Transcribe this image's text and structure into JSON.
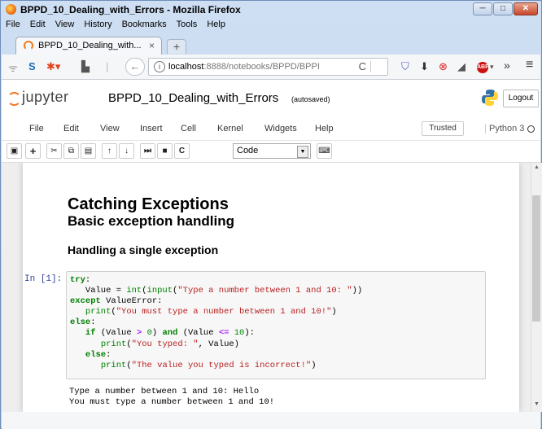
{
  "window": {
    "title": "BPPD_10_Dealing_with_Errors - Mozilla Firefox",
    "minimize_glyph": "─",
    "restore_glyph": "□",
    "close_glyph": "✕"
  },
  "menubar": [
    "File",
    "Edit",
    "View",
    "History",
    "Bookmarks",
    "Tools",
    "Help"
  ],
  "tab": {
    "label": "BPPD_10_Dealing_with...",
    "close": "×",
    "new": "+"
  },
  "navbar": {
    "url_host": "localhost",
    "url_path": ":8888/notebooks/BPPD/BPPI",
    "back_glyph": "←",
    "reload_glyph": "C",
    "abp_label": "ABP",
    "overflow_glyph": "»",
    "menu_glyph": "≡"
  },
  "jupyter": {
    "brand": "jupyter",
    "notebook_title": "BPPD_10_Dealing_with_Errors",
    "autosave": "(autosaved)",
    "logout": "Logout",
    "menu": [
      "File",
      "Edit",
      "View",
      "Insert",
      "Cell",
      "Kernel",
      "Widgets",
      "Help"
    ],
    "trusted": "Trusted",
    "kernel": "Python 3",
    "cell_type": "Code"
  },
  "toolbar_icons": [
    "save-icon",
    "add-cell-icon",
    "cut-icon",
    "copy-icon",
    "paste-icon",
    "move-up-icon",
    "move-down-icon",
    "run-icon",
    "stop-icon",
    "restart-icon",
    "keyboard-icon"
  ],
  "notebook": {
    "h1": "Catching Exceptions",
    "h2": "Basic exception handling",
    "h3": "Handling a single exception",
    "prompt": "In [1]:",
    "code_lines": [
      "try:",
      "   Value = int(input(\"Type a number between 1 and 10: \"))",
      "except ValueError:",
      "   print(\"You must type a number between 1 and 10!\")",
      "else:",
      "   if (Value > 0) and (Value <= 10):",
      "      print(\"You typed: \", Value)",
      "   else:",
      "      print(\"The value you typed is incorrect!\")"
    ],
    "output_lines": [
      "Type a number between 1 and 10: Hello",
      "You must type a number between 1 and 10!"
    ]
  }
}
